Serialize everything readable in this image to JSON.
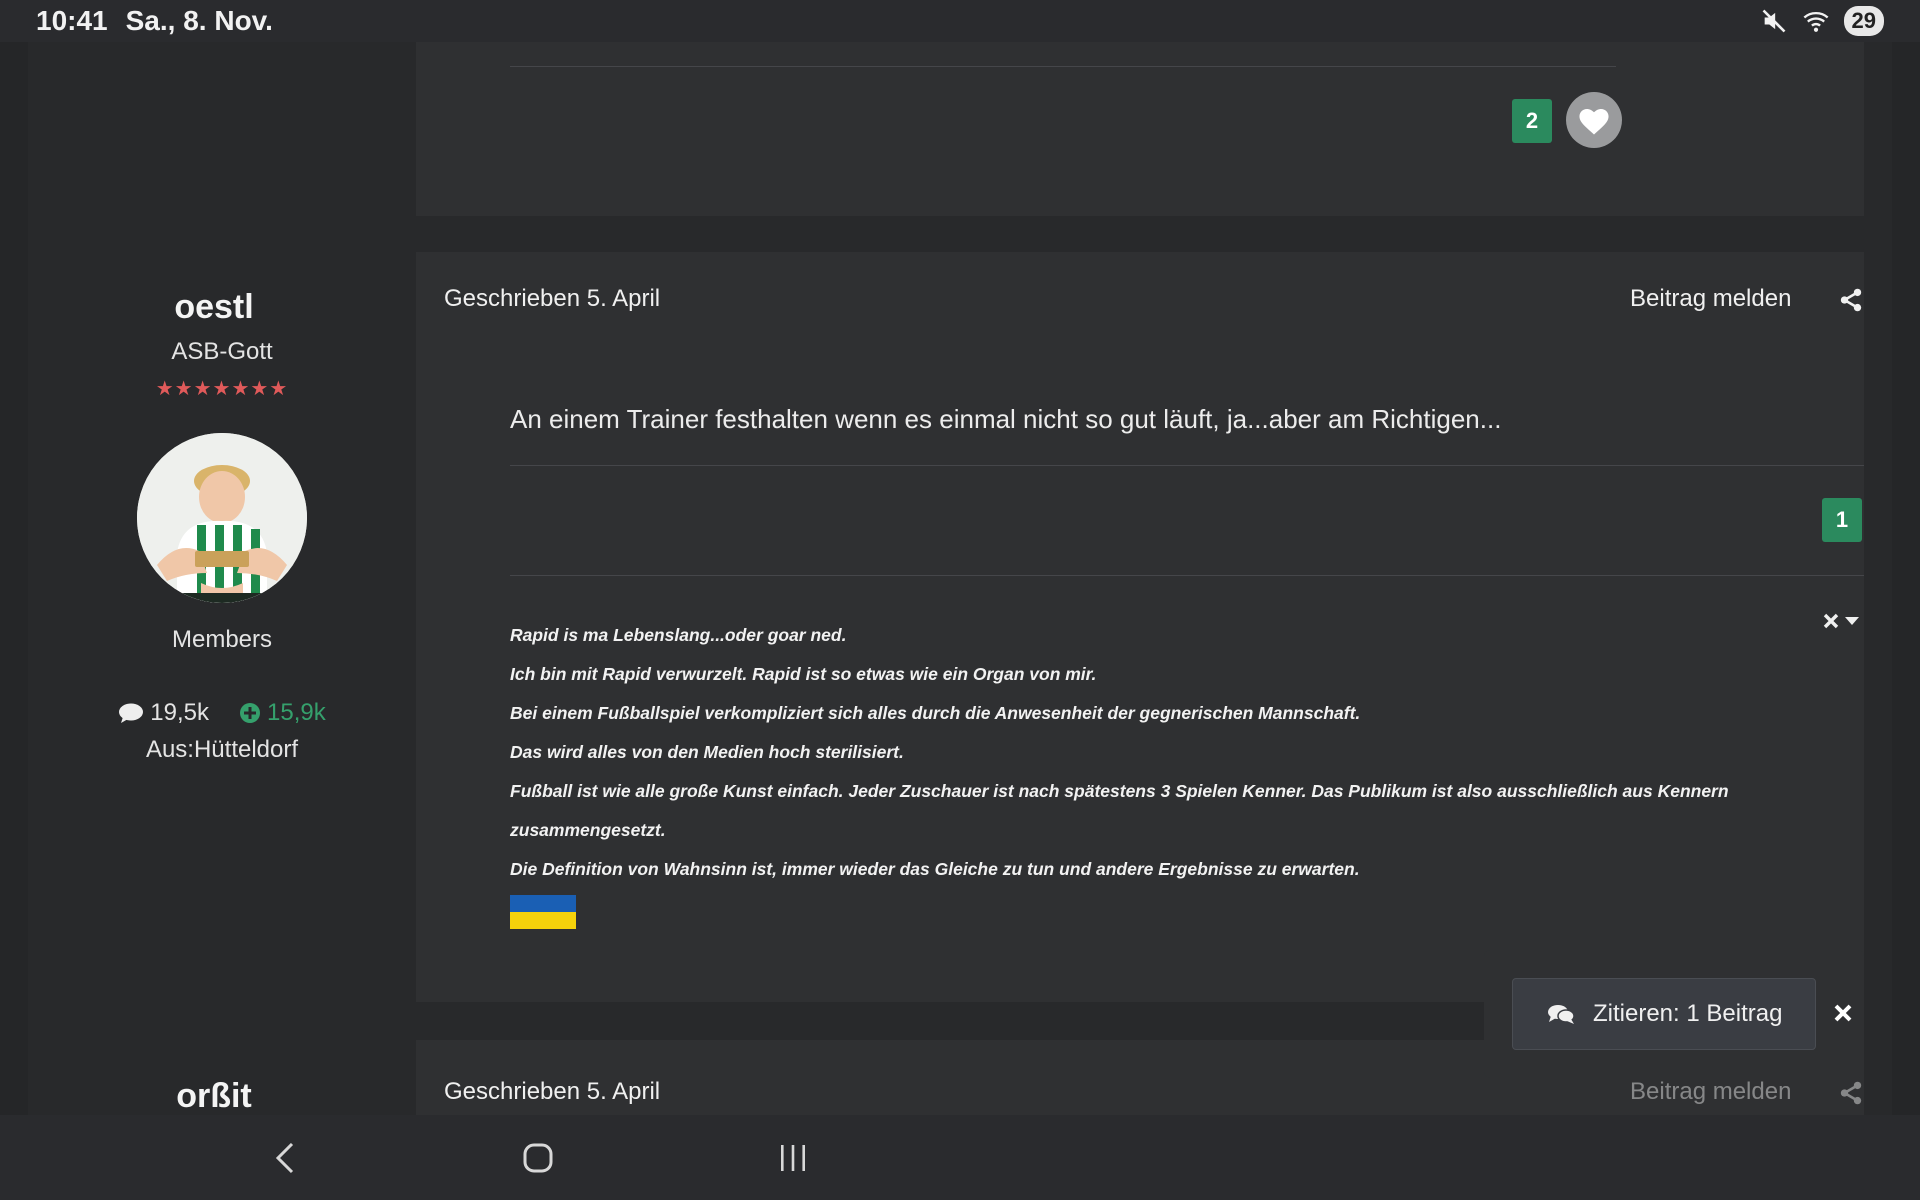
{
  "status_bar": {
    "time": "10:41",
    "date": "Sa., 8. Nov.",
    "battery": "29",
    "icons": [
      "mute-icon",
      "wifi-icon",
      "battery-icon"
    ]
  },
  "previous_post": {
    "reaction_count": "2"
  },
  "post": {
    "author": {
      "name": "oestl",
      "rank": "ASB-Gott",
      "stars": "★★★★★★★",
      "group": "Members",
      "posts_count": "19,5k",
      "reputation": "15,9k",
      "location": "Aus:Hütteldorf"
    },
    "date": "Geschrieben 5. April",
    "report_label": "Beitrag melden",
    "content": "An einem Trainer festhalten wenn es einmal nicht so gut läuft, ja...aber am Richtigen...",
    "reaction_count": "1",
    "signature": [
      "Rapid is ma Lebenslang...oder goar ned.",
      "Ich bin mit Rapid verwurzelt. Rapid ist so etwas wie ein Organ von mir.",
      "Bei einem Fußballspiel verkompliziert sich alles durch die Anwesenheit der gegnerischen Mannschaft.",
      "Das wird alles von den Medien hoch sterilisiert.",
      "Fußball ist wie alle große Kunst einfach. Jeder Zuschauer ist nach spätestens 3 Spielen Kenner. Das Publikum ist also ausschließlich aus Kennern",
      "zusammengesetzt.",
      "Die Definition von Wahnsinn ist, immer wieder das Gleiche zu tun und andere Ergebnisse zu erwarten."
    ]
  },
  "next_post": {
    "author_name": "orßit",
    "date": "Geschrieben 5. April",
    "report_label": "Beitrag melden"
  },
  "quote_popup": {
    "label": "Zitieren: 1 Beitrag"
  },
  "colors": {
    "accent_green": "#2b8a5e",
    "reputation_green": "#35a06c",
    "stars_red": "#e05a5a",
    "background": "#28292b",
    "post_background": "#2f3032"
  }
}
